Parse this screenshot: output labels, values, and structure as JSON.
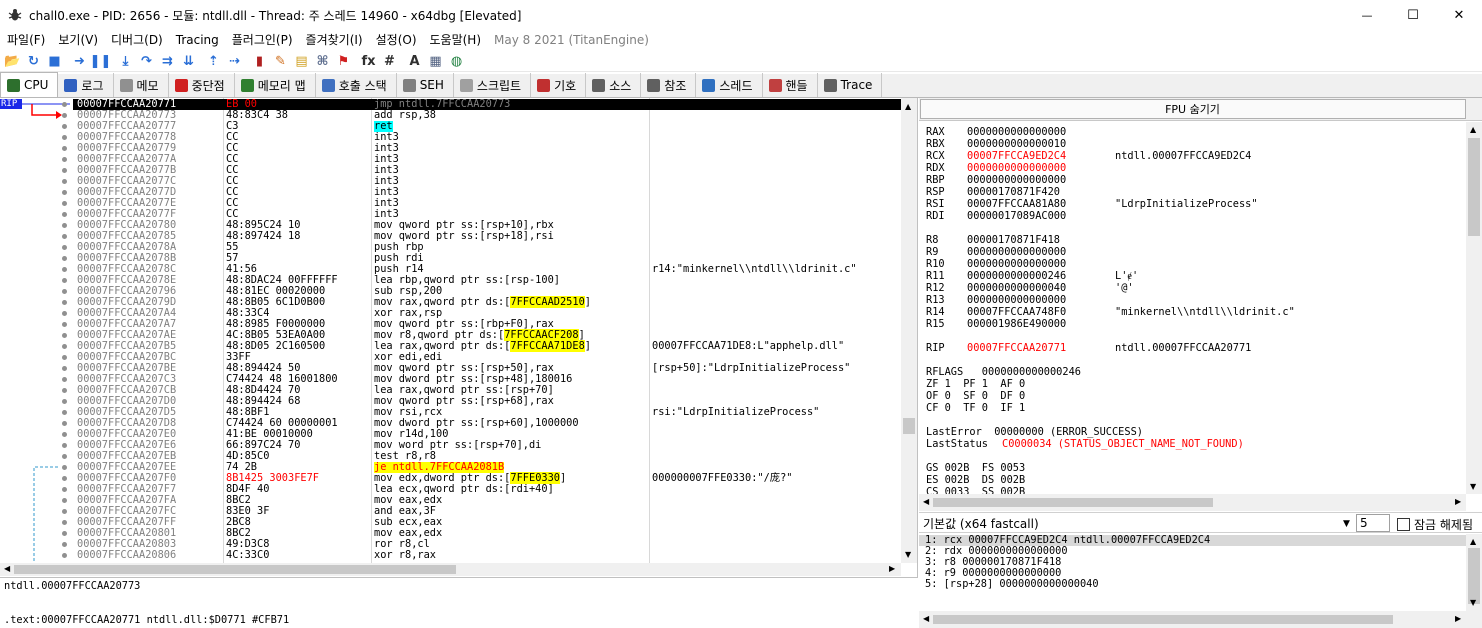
{
  "window": {
    "title": "chall0.exe - PID: 2656 - 모듈: ntdll.dll - Thread: 주 스레드 14960 - x64dbg [Elevated]",
    "minimize_glyph": "—",
    "maximize_glyph": "☐",
    "close_glyph": "✕"
  },
  "menu": {
    "items": [
      "파일(F)",
      "보기(V)",
      "디버그(D)",
      "Tracing",
      "플러그인(P)",
      "즐겨찾기(I)",
      "설정(O)",
      "도움말(H)"
    ],
    "build": "May 8 2021 (TitanEngine)"
  },
  "toolbar": {
    "buttons": [
      {
        "name": "open-icon",
        "glyph": "📂",
        "color": "#e0a800"
      },
      {
        "name": "restart-icon",
        "glyph": "↻",
        "color": "#2b6fd6"
      },
      {
        "name": "stop-icon",
        "glyph": "■",
        "color": "#2b6fd6"
      },
      {
        "name": "run-icon",
        "glyph": "➜",
        "color": "#2b6fd6"
      },
      {
        "name": "pause-icon",
        "glyph": "❚❚",
        "color": "#2b6fd6"
      },
      {
        "name": "step-into-icon",
        "glyph": "⤓",
        "color": "#2b6fd6"
      },
      {
        "name": "step-over-icon",
        "glyph": "↷",
        "color": "#2b6fd6"
      },
      {
        "name": "trace-into-icon",
        "glyph": "⇉",
        "color": "#2b6fd6"
      },
      {
        "name": "trace-over-icon",
        "glyph": "⇊",
        "color": "#2b6fd6"
      },
      {
        "name": "execute-till-return-icon",
        "glyph": "⇡",
        "color": "#2b6fd6"
      },
      {
        "name": "run-to-user-code-icon",
        "glyph": "⇢",
        "color": "#2b6fd6"
      },
      {
        "name": "memory-icon",
        "glyph": "▮",
        "color": "#b02020"
      },
      {
        "name": "patch-icon",
        "glyph": "✎",
        "color": "#d07020"
      },
      {
        "name": "comments-icon",
        "glyph": "▤",
        "color": "#d0a020"
      },
      {
        "name": "labels-icon",
        "glyph": "⌘",
        "color": "#607090"
      },
      {
        "name": "bookmarks-icon",
        "glyph": "⚑",
        "color": "#d02020"
      },
      {
        "name": "functions-icon",
        "glyph": "fx",
        "color": "#303030"
      },
      {
        "name": "hash-icon",
        "glyph": "#",
        "color": "#303030"
      },
      {
        "name": "font-icon",
        "glyph": "A",
        "color": "#303030"
      },
      {
        "name": "calculator-icon",
        "glyph": "▦",
        "color": "#506080"
      },
      {
        "name": "globe-icon",
        "glyph": "◍",
        "color": "#208040"
      }
    ]
  },
  "tabs": [
    {
      "name": "tab-cpu",
      "label": "CPU",
      "color": "#2d6f2d",
      "active": true
    },
    {
      "name": "tab-log",
      "label": "로그",
      "color": "#3060c0"
    },
    {
      "name": "tab-notes",
      "label": "메모",
      "color": "#909090"
    },
    {
      "name": "tab-breakpoints",
      "label": "중단점",
      "color": "#d02020"
    },
    {
      "name": "tab-memory-map",
      "label": "메모리 맵",
      "color": "#308030"
    },
    {
      "name": "tab-call-stack",
      "label": "호출 스택",
      "color": "#4070c0"
    },
    {
      "name": "tab-seh",
      "label": "SEH",
      "color": "#808080"
    },
    {
      "name": "tab-script",
      "label": "스크립트",
      "color": "#a0a0a0"
    },
    {
      "name": "tab-symbols",
      "label": "기호",
      "color": "#c03030"
    },
    {
      "name": "tab-source",
      "label": "소스",
      "color": "#606060"
    },
    {
      "name": "tab-references",
      "label": "참조",
      "color": "#606060"
    },
    {
      "name": "tab-threads",
      "label": "스레드",
      "color": "#3070c0"
    },
    {
      "name": "tab-handles",
      "label": "핸들",
      "color": "#c04040"
    },
    {
      "name": "tab-trace",
      "label": "Trace",
      "color": "#606060"
    }
  ],
  "disasm": {
    "rip_label": "RIP",
    "rows": [
      {
        "addr": "00007FFCCAA20771",
        "bytes": "EB 00",
        "instr": "jmp ntdll.7FFCCAA20773",
        "comment": ""
      },
      {
        "addr": "00007FFCCAA20773",
        "bytes": "48:83C4 38",
        "instr": "add rsp,38",
        "comment": ""
      },
      {
        "addr": "00007FFCCAA20777",
        "bytes": "C3",
        "instr": "ret",
        "comment": ""
      },
      {
        "addr": "00007FFCCAA20778",
        "bytes": "CC",
        "instr": "int3",
        "comment": ""
      },
      {
        "addr": "00007FFCCAA20779",
        "bytes": "CC",
        "instr": "int3",
        "comment": ""
      },
      {
        "addr": "00007FFCCAA2077A",
        "bytes": "CC",
        "instr": "int3",
        "comment": ""
      },
      {
        "addr": "00007FFCCAA2077B",
        "bytes": "CC",
        "instr": "int3",
        "comment": ""
      },
      {
        "addr": "00007FFCCAA2077C",
        "bytes": "CC",
        "instr": "int3",
        "comment": ""
      },
      {
        "addr": "00007FFCCAA2077D",
        "bytes": "CC",
        "instr": "int3",
        "comment": ""
      },
      {
        "addr": "00007FFCCAA2077E",
        "bytes": "CC",
        "instr": "int3",
        "comment": ""
      },
      {
        "addr": "00007FFCCAA2077F",
        "bytes": "CC",
        "instr": "int3",
        "comment": ""
      },
      {
        "addr": "00007FFCCAA20780",
        "bytes": "48:895C24 10",
        "instr": "mov qword ptr ss:[rsp+10],rbx",
        "comment": ""
      },
      {
        "addr": "00007FFCCAA20785",
        "bytes": "48:897424 18",
        "instr": "mov qword ptr ss:[rsp+18],rsi",
        "comment": ""
      },
      {
        "addr": "00007FFCCAA2078A",
        "bytes": "55",
        "instr": "push rbp",
        "comment": ""
      },
      {
        "addr": "00007FFCCAA2078B",
        "bytes": "57",
        "instr": "push rdi",
        "comment": ""
      },
      {
        "addr": "00007FFCCAA2078C",
        "bytes": "41:56",
        "instr": "push r14",
        "comment": "r14:\"minkernel\\\\ntdll\\\\ldrinit.c\""
      },
      {
        "addr": "00007FFCCAA2078E",
        "bytes": "48:8DAC24 00FFFFFF",
        "instr": "lea rbp,qword ptr ss:[rsp-100]",
        "comment": ""
      },
      {
        "addr": "00007FFCCAA20796",
        "bytes": "48:81EC 00020000",
        "instr": "sub rsp,200",
        "comment": ""
      },
      {
        "addr": "00007FFCCAA2079D",
        "bytes": "48:8B05 6C1D0B00",
        "instr": "mov rax,qword ptr ds:[7FFCCAAD2510]",
        "comment": ""
      },
      {
        "addr": "00007FFCCAA207A4",
        "bytes": "48:33C4",
        "instr": "xor rax,rsp",
        "comment": ""
      },
      {
        "addr": "00007FFCCAA207A7",
        "bytes": "48:8985 F0000000",
        "instr": "mov qword ptr ss:[rbp+F0],rax",
        "comment": ""
      },
      {
        "addr": "00007FFCCAA207AE",
        "bytes": "4C:8B05 53EA0A00",
        "instr": "mov r8,qword ptr ds:[7FFCCAACF208]",
        "comment": ""
      },
      {
        "addr": "00007FFCCAA207B5",
        "bytes": "48:8D05 2C160500",
        "instr": "lea rax,qword ptr ds:[7FFCCAA71DE8]",
        "comment": "00007FFCCAA71DE8:L\"apphelp.dll\""
      },
      {
        "addr": "00007FFCCAA207BC",
        "bytes": "33FF",
        "instr": "xor edi,edi",
        "comment": ""
      },
      {
        "addr": "00007FFCCAA207BE",
        "bytes": "48:894424 50",
        "instr": "mov qword ptr ss:[rsp+50],rax",
        "comment": "[rsp+50]:\"LdrpInitializeProcess\""
      },
      {
        "addr": "00007FFCCAA207C3",
        "bytes": "C74424 48 16001800",
        "instr": "mov dword ptr ss:[rsp+48],180016",
        "comment": ""
      },
      {
        "addr": "00007FFCCAA207CB",
        "bytes": "48:8D4424 70",
        "instr": "lea rax,qword ptr ss:[rsp+70]",
        "comment": ""
      },
      {
        "addr": "00007FFCCAA207D0",
        "bytes": "48:894424 68",
        "instr": "mov qword ptr ss:[rsp+68],rax",
        "comment": ""
      },
      {
        "addr": "00007FFCCAA207D5",
        "bytes": "48:8BF1",
        "instr": "mov rsi,rcx",
        "comment": "rsi:\"LdrpInitializeProcess\""
      },
      {
        "addr": "00007FFCCAA207D8",
        "bytes": "C74424 60 00000001",
        "instr": "mov dword ptr ss:[rsp+60],1000000",
        "comment": ""
      },
      {
        "addr": "00007FFCCAA207E0",
        "bytes": "41:BE 00010000",
        "instr": "mov r14d,100",
        "comment": ""
      },
      {
        "addr": "00007FFCCAA207E6",
        "bytes": "66:897C24 70",
        "instr": "mov word ptr ss:[rsp+70],di",
        "comment": ""
      },
      {
        "addr": "00007FFCCAA207EB",
        "bytes": "4D:85C0",
        "instr": "test r8,r8",
        "comment": ""
      },
      {
        "addr": "00007FFCCAA207EE",
        "bytes": "74 2B",
        "instr": "je ntdll.7FFCCAA2081B",
        "comment": ""
      },
      {
        "addr": "00007FFCCAA207F0",
        "bytes": "8B1425 3003FE7F",
        "instr": "mov edx,dword ptr ds:[7FFE0330]",
        "comment": "000000007FFE0330:\"/庞?\""
      },
      {
        "addr": "00007FFCCAA207F7",
        "bytes": "8D4F 40",
        "instr": "lea ecx,qword ptr ds:[rdi+40]",
        "comment": ""
      },
      {
        "addr": "00007FFCCAA207FA",
        "bytes": "8BC2",
        "instr": "mov eax,edx",
        "comment": ""
      },
      {
        "addr": "00007FFCCAA207FC",
        "bytes": "83E0 3F",
        "instr": "and eax,3F",
        "comment": ""
      },
      {
        "addr": "00007FFCCAA207FF",
        "bytes": "2BC8",
        "instr": "sub ecx,eax",
        "comment": ""
      },
      {
        "addr": "00007FFCCAA20801",
        "bytes": "8BC2",
        "instr": "mov eax,edx",
        "comment": ""
      },
      {
        "addr": "00007FFCCAA20803",
        "bytes": "49:D3C8",
        "instr": "ror r8,cl",
        "comment": ""
      },
      {
        "addr": "00007FFCCAA20806",
        "bytes": "4C:33C0",
        "instr": "xor r8,rax",
        "comment": ""
      }
    ]
  },
  "info": {
    "line1": "ntdll.00007FFCCAA20773",
    "line2": ".text:00007FFCCAA20771 ntdll.dll:$D0771 #CFB71"
  },
  "registers": {
    "fpu_toggle": "FPU 숨기기",
    "gp": [
      {
        "name": "RAX",
        "value": "0000000000000000",
        "sym": ""
      },
      {
        "name": "RBX",
        "value": "0000000000000010",
        "sym": ""
      },
      {
        "name": "RCX",
        "value": "00007FFCCA9ED2C4",
        "sym": "ntdll.00007FFCCA9ED2C4"
      },
      {
        "name": "RDX",
        "value": "0000000000000000",
        "sym": ""
      },
      {
        "name": "RBP",
        "value": "0000000000000000",
        "sym": ""
      },
      {
        "name": "RSP",
        "value": "00000170871F420",
        "sym": ""
      },
      {
        "name": "RSI",
        "value": "00007FFCCAA81A80",
        "sym": "\"LdrpInitializeProcess\""
      },
      {
        "name": "RDI",
        "value": "00000017089AC000",
        "sym": ""
      }
    ],
    "ext": [
      {
        "name": "R8",
        "value": "00000170871F418",
        "sym": ""
      },
      {
        "name": "R9",
        "value": "0000000000000000",
        "sym": ""
      },
      {
        "name": "R10",
        "value": "0000000000000000",
        "sym": ""
      },
      {
        "name": "R11",
        "value": "0000000000000246",
        "sym": "L'ɇ'"
      },
      {
        "name": "R12",
        "value": "0000000000000040",
        "sym": "'@'"
      },
      {
        "name": "R13",
        "value": "0000000000000000",
        "sym": ""
      },
      {
        "name": "R14",
        "value": "00007FFCCAA748F0",
        "sym": "\"minkernel\\\\ntdll\\\\ldrinit.c\""
      },
      {
        "name": "R15",
        "value": "000001986E490000",
        "sym": ""
      }
    ],
    "rip": {
      "name": "RIP",
      "value": "00007FFCCAA20771",
      "sym": "ntdll.00007FFCCAA20771"
    },
    "rflags_line": "RFLAGS   0000000000000246",
    "flags1": "ZF 1  PF 1  AF 0",
    "flags2": "OF 0  SF 0  DF 0",
    "flags3": "CF 0  TF 0  IF 1",
    "lasterror": "LastError  00000000 (ERROR_SUCCESS)",
    "laststatus_label": "LastStatus",
    "laststatus_value": "C0000034 (STATUS_OBJECT_NAME_NOT_FOUND)",
    "seg1": "GS 002B  FS 0053",
    "seg2": "ES 002B  DS 002B",
    "seg3": "CS 0033  SS 002B"
  },
  "callconv": {
    "selected": "기본값 (x64 fastcall)",
    "arg_count": "5",
    "lock_label": "잠금 해제됨",
    "args": [
      "1: rcx 00007FFCCA9ED2C4 ntdll.00007FFCCA9ED2C4",
      "2: rdx 0000000000000000",
      "3: r8 000000170871F418",
      "4: r9 0000000000000000",
      "5: [rsp+28] 0000000000000040"
    ]
  },
  "colors": {
    "selection": "#000000",
    "changed_register": "#ff0000",
    "rip_badge": "#1a28e8",
    "mem_highlight": "#ffff00",
    "ret_highlight": "#00ffff",
    "disasm_bytes_jump": "#ff0000",
    "comment_text": "#804000"
  }
}
